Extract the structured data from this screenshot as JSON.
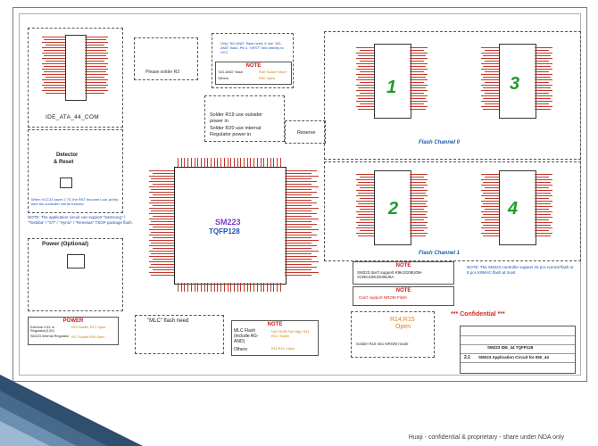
{
  "connector": {
    "title": "IDE_ATA_44_COM"
  },
  "detector": {
    "title_line1": "Detector",
    "title_line2": "& Reset",
    "warning": "When VCC33 lower 2.7V, the RST become Low, at this time the controller will be freezed."
  },
  "note_support": {
    "text": "NOTE: The application circuit can support \"Samsung\" / \"Toshiba\" / \"ST\" / \"Hynix\" / \"Renesas\" TSOP package flash."
  },
  "power_optional": {
    "title": "Power (Optional)"
  },
  "power_table": {
    "header": "POWER",
    "rows": [
      {
        "name": "External 3.3V or Regulator(3.3V)",
        "value": "R16 Solder, R17 Open"
      },
      {
        "name": "SM223 Internal Regulator",
        "value": "R17 Solder R16 Open"
      }
    ]
  },
  "solder_note": {
    "text": "Please solder R3"
  },
  "agand_note": {
    "text": "Only \"AG-AND\" flash need, if use \"AG-AND\" flash, Pin 1 \"nRST\" tied directly to VCC."
  },
  "agand_table": {
    "header": "NOTE",
    "rows": [
      {
        "name": "\"AG-AND\" flash",
        "value": "R40 Solder Short"
      },
      {
        "name": "Others",
        "value": "R40 Open"
      }
    ]
  },
  "regulator_note": {
    "line1": "Solder R19 use outsider",
    "line2": "power in",
    "line3": "Solder R20 use internal",
    "line4": "Regulator  power in"
  },
  "reserve": {
    "label": "Reserve"
  },
  "controller": {
    "name": "SM223",
    "package": "TQFP128"
  },
  "flash_channels": [
    {
      "label": "Flash Channel 0"
    },
    {
      "label": "Flash Channel 1"
    }
  ],
  "flash_numbers": [
    "1",
    "3",
    "2",
    "4"
  ],
  "nrom_note": {
    "header": "NOTE",
    "text": "SM223 don't support K9K2G08U0M-VCB0,K9K2G08U0A"
  },
  "nrom_note2": {
    "header": "NOTE",
    "text": "Can't support NROM Flash"
  },
  "r14_note": {
    "line1": "R14,R15",
    "line2": "Open"
  },
  "r19_note": {
    "text": "Solder R19 into NROM mode"
  },
  "mlc_note": {
    "title": "\"MLC\" flash need"
  },
  "mlc_table": {
    "header": "NOTE",
    "rows": [
      {
        "name": "MLC Flash (include AG-AND)",
        "value": "Not YSGB Pull High, R11 R12: Solder"
      },
      {
        "name": "Others",
        "value": "R11,R12: Open"
      }
    ]
  },
  "controller_note": {
    "text": "NOTE: The SM223 controller support 16 pcs normal flash or 8 pcs K9MAG flash at most"
  },
  "confidential": {
    "text": "*** Confidential ***"
  },
  "title_block": {
    "company": "SM223 IDE_44 TQFP128",
    "title": "SM223 Application Circuit for IDE_44",
    "rev": "2.1"
  },
  "footer": {
    "text": "Huaji - confidential & proprietary - share under NDA only"
  }
}
